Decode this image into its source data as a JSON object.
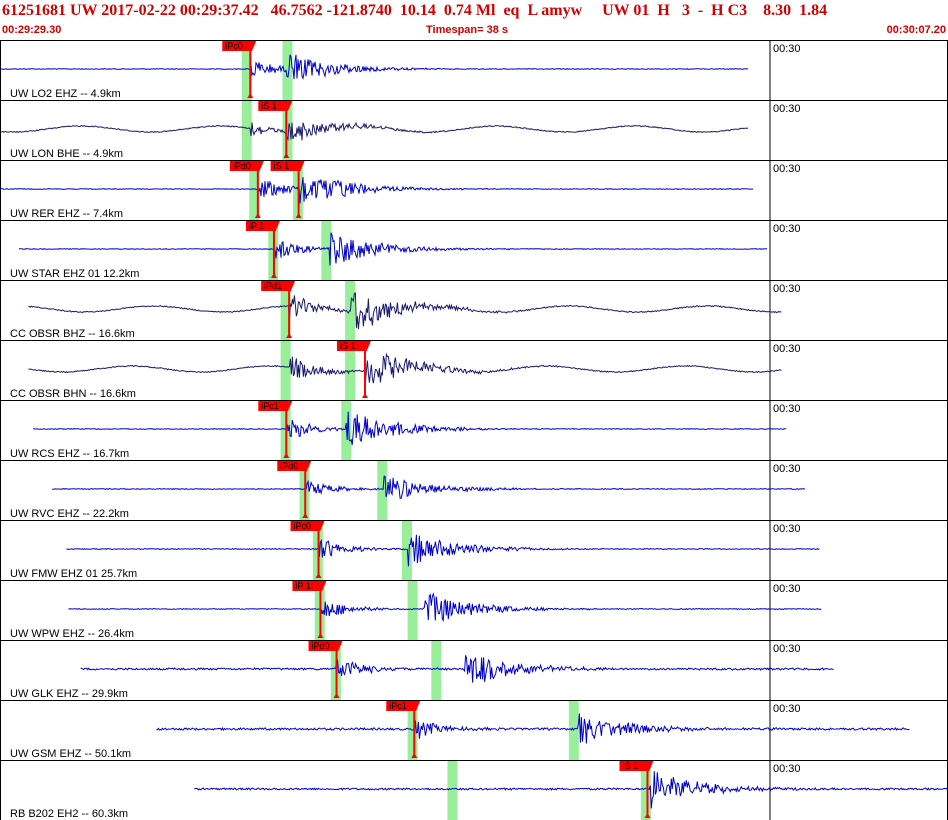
{
  "header": {
    "title": "61251681 UW 2017-02-22 00:29:37.42   46.7562 -121.8740  10.14  0.74 Ml  eq  L amyw     UW 01  H   3  -  H C3    8.30  1.84",
    "start_time": "00:29:29.30",
    "timespan": "Timespan=  38 s",
    "end_time": "00:30:07.20"
  },
  "colors": {
    "header_text": "#d00000",
    "trace_blue": "#0000cc",
    "trace_dark": "#1a1a6e",
    "pick_red": "#ff0000",
    "window_green": "#99ee99"
  },
  "minute_label": "00:30",
  "traces": [
    {
      "label": "UW LO2 EHZ -- 4.9km",
      "color": "blue",
      "start": 0.0,
      "end": 0.79,
      "amp": 1.2,
      "p": 0.264,
      "s": 0.302,
      "noise": 0.12,
      "windows": [
        0.255,
        0.298
      ],
      "picks": [
        {
          "t": 0.264,
          "label": "iPc0",
          "flag": "left"
        }
      ]
    },
    {
      "label": "UW LON BHE -- 4.9km",
      "color": "dark",
      "start": 0.0,
      "end": 0.79,
      "amp": 0.9,
      "p": 0.264,
      "s": 0.302,
      "noise": 0.18,
      "windows": [
        0.255,
        0.298
      ],
      "picks": [
        {
          "t": 0.302,
          "label": "iS 1",
          "flag": "left"
        }
      ]
    },
    {
      "label": "UW RER EHZ -- 7.4km",
      "color": "blue",
      "start": 0.0,
      "end": 0.795,
      "amp": 1.4,
      "p": 0.272,
      "s": 0.315,
      "noise": 0.12,
      "windows": [
        0.263,
        0.309
      ],
      "picks": [
        {
          "t": 0.272,
          "label": "iPd0",
          "flag": "left"
        },
        {
          "t": 0.315,
          "label": "iS 1",
          "flag": "left"
        }
      ]
    },
    {
      "label": "UW STAR EHZ 01 12.2km",
      "color": "blue",
      "start": 0.02,
      "end": 0.81,
      "amp": 1.3,
      "p": 0.289,
      "s": 0.348,
      "noise": 0.12,
      "windows": [
        0.283,
        0.339
      ],
      "picks": [
        {
          "t": 0.289,
          "label": "iP 1",
          "flag": "left"
        }
      ]
    },
    {
      "label": "CC OBSR BHZ -- 16.6km",
      "color": "dark",
      "start": 0.03,
      "end": 0.825,
      "amp": 1.6,
      "p": 0.305,
      "s": 0.37,
      "noise": 0.18,
      "windows": [
        0.296,
        0.364
      ],
      "picks": [
        {
          "t": 0.305,
          "label": "iPd1",
          "flag": "left"
        }
      ]
    },
    {
      "label": "CC OBSR BHN -- 16.6km",
      "color": "dark",
      "start": 0.03,
      "end": 0.825,
      "amp": 1.5,
      "p": 0.305,
      "s": 0.385,
      "noise": 0.18,
      "windows": [
        0.296,
        0.364
      ],
      "picks": [
        {
          "t": 0.385,
          "label": "iS 1",
          "flag": "left"
        }
      ]
    },
    {
      "label": "UW RCS EHZ -- 16.7km",
      "color": "blue",
      "start": 0.035,
      "end": 0.83,
      "amp": 1.4,
      "p": 0.302,
      "s": 0.365,
      "noise": 0.12,
      "windows": [
        0.296,
        0.36
      ],
      "picks": [
        {
          "t": 0.302,
          "label": "iPc1",
          "flag": "left"
        }
      ]
    },
    {
      "label": "UW RVC EHZ -- 22.2km",
      "color": "blue",
      "start": 0.055,
      "end": 0.85,
      "amp": 1.0,
      "p": 0.322,
      "s": 0.405,
      "noise": 0.14,
      "windows": [
        0.316,
        0.398
      ],
      "picks": [
        {
          "t": 0.322,
          "label": "iPd0",
          "flag": "left"
        }
      ]
    },
    {
      "label": "UW FMW EHZ 01 25.7km",
      "color": "blue",
      "start": 0.07,
      "end": 0.865,
      "amp": 1.3,
      "p": 0.336,
      "s": 0.43,
      "noise": 0.14,
      "windows": [
        0.33,
        0.424
      ],
      "picks": [
        {
          "t": 0.336,
          "label": "iPc0",
          "flag": "left"
        }
      ]
    },
    {
      "label": "UW WPW EHZ -- 26.4km",
      "color": "blue",
      "start": 0.072,
      "end": 0.867,
      "amp": 1.3,
      "p": 0.338,
      "s": 0.447,
      "noise": 0.14,
      "windows": [
        0.332,
        0.43
      ],
      "picks": [
        {
          "t": 0.338,
          "label": "iP 1",
          "flag": "left"
        }
      ]
    },
    {
      "label": "UW GLK EHZ -- 29.9km",
      "color": "blue",
      "start": 0.085,
      "end": 0.88,
      "amp": 1.4,
      "p": 0.355,
      "s": 0.49,
      "noise": 0.32,
      "windows": [
        0.349,
        0.455
      ],
      "picks": [
        {
          "t": 0.355,
          "label": "iPd0",
          "flag": "left"
        }
      ]
    },
    {
      "label": "UW GSM EHZ -- 50.1km",
      "color": "blue",
      "start": 0.165,
      "end": 0.96,
      "amp": 1.2,
      "p": 0.437,
      "s": 0.61,
      "noise": 0.36,
      "windows": [
        0.43,
        0.6
      ],
      "picks": [
        {
          "t": 0.437,
          "label": "iPc1",
          "flag": "left"
        }
      ]
    },
    {
      "label": "RB B202 EH2 -- 60.3km",
      "color": "blue",
      "start": 0.205,
      "end": 1.0,
      "amp": 1.3,
      "p": 0.685,
      "s": 0.685,
      "noise": 0.3,
      "windows": [
        0.472,
        0.676
      ],
      "picks": [
        {
          "t": 0.683,
          "label": "iS 1",
          "flag": "left"
        }
      ]
    }
  ]
}
